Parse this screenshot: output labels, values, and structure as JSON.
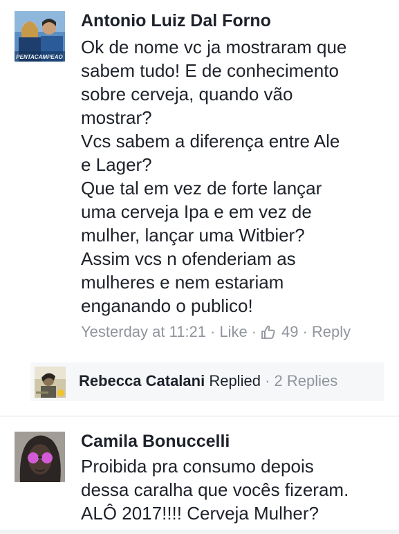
{
  "comments": [
    {
      "author": "Antonio Luiz Dal Forno",
      "avatar_caption": "PENTACAMPEAO",
      "lines": [
        "Ok de nome vc ja mostraram que",
        "sabem tudo! E de conhecimento",
        "sobre cerveja, quando vão",
        "mostrar?",
        "Vcs sabem a diferença entre Ale",
        "e Lager?",
        "Que tal em vez de forte lançar",
        "uma cerveja Ipa e em vez de",
        "mulher, lançar uma Witbier?",
        "Assim vcs n ofenderiam as",
        "mulheres e nem estariam",
        "enganando o publico!"
      ],
      "timestamp": "Yesterday at 11:21",
      "like_label": "Like",
      "like_count": "49",
      "reply_label": "Reply"
    },
    {
      "author": "Camila Bonuccelli",
      "lines": [
        "Proibida pra consumo depois",
        "dessa caralha que vocês fizeram.",
        "ALÔ 2017!!!! Cerveja Mulher?"
      ]
    }
  ],
  "replies": {
    "author": "Rebecca Catalani",
    "replied_word": "Replied",
    "count_text": "2 Replies"
  },
  "colors": {
    "text": "#1d2129",
    "meta": "#90949c",
    "reply_bg": "#f6f7f9",
    "divider": "#dddfe2"
  }
}
